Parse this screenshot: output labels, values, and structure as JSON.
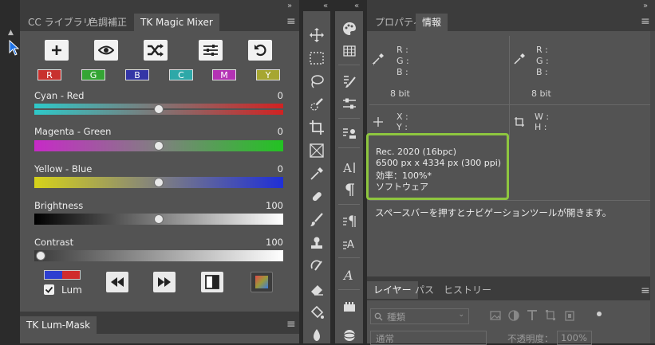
{
  "collapse_glyph": "»",
  "expand_glyph": "«",
  "menu_glyph": "≡",
  "left_panel": {
    "tabs": [
      {
        "label": "CC ライブラリ",
        "active": false
      },
      {
        "label": "色調補正",
        "active": false
      },
      {
        "label": "TK Magic Mixer",
        "active": true
      }
    ],
    "toolbar_icons": [
      "plus-icon",
      "eye-icon",
      "shuffle-icon",
      "sliders-icon",
      "undo-icon"
    ],
    "channels": [
      {
        "label": "R",
        "color": "#c8312e"
      },
      {
        "label": "G",
        "color": "#34a534"
      },
      {
        "label": "B",
        "color": "#3436a6"
      },
      {
        "label": "C",
        "color": "#2ea8a8"
      },
      {
        "label": "M",
        "color": "#b432b4"
      },
      {
        "label": "Y",
        "color": "#a6a631"
      }
    ],
    "sliders": [
      {
        "label": "Cyan - Red",
        "value": "0",
        "position": 0.5
      },
      {
        "label": "Magenta - Green",
        "value": "0",
        "position": 0.5
      },
      {
        "label": "Yellow - Blue",
        "value": "0",
        "position": 0.5
      },
      {
        "label": "Brightness",
        "value": "100",
        "position": 0.5
      },
      {
        "label": "Contrast",
        "value": "100",
        "position": 0.0
      }
    ],
    "lum_label": "Lum",
    "lum_checked": true,
    "bottom_tab": "TK Lum-Mask"
  },
  "right_panel": {
    "tabs": [
      {
        "label": "プロパティ",
        "active": false
      },
      {
        "label": "情報",
        "active": true
      }
    ],
    "rgb_left": {
      "labels": [
        "R :",
        "G :",
        "B :"
      ],
      "bit": "8 bit"
    },
    "rgb_right": {
      "labels": [
        "R :",
        "G :",
        "B :"
      ],
      "bit": "8 bit"
    },
    "xy_labels": [
      "X :",
      "Y :"
    ],
    "wh_labels": [
      "W :",
      "H :"
    ],
    "doc_info": [
      "Rec. 2020 (16bpc)",
      "6500 px x 4334 px (300 ppi)",
      "効率：100%*",
      "ソフトウェア"
    ],
    "hint": "スペースバーを押すとナビゲーションツールが開きます。",
    "highlight_color": "#8ec63f"
  },
  "layers_panel": {
    "tabs": [
      {
        "label": "レイヤー",
        "active": true
      },
      {
        "label": "パス",
        "active": false
      },
      {
        "label": "ヒストリー",
        "active": false
      }
    ],
    "filter_kind": "種類",
    "blend_mode": "通常",
    "opacity_label": "不透明度：",
    "opacity_value": "100%"
  }
}
